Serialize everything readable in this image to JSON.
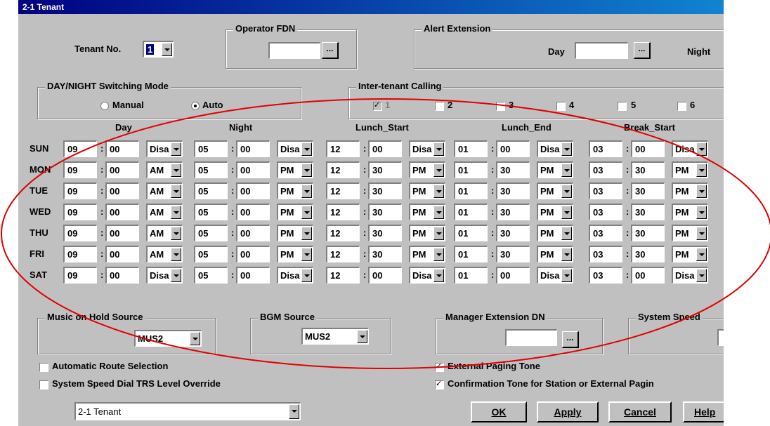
{
  "window": {
    "title": "2-1 Tenant"
  },
  "tenant": {
    "label": "Tenant No.",
    "value": "1"
  },
  "operator_fdn": {
    "label": "Operator FDN",
    "value": ""
  },
  "alert_extension": {
    "label": "Alert Extension",
    "day_label": "Day",
    "night_label": "Night",
    "day_value": ""
  },
  "switching_mode": {
    "label": "DAY/NIGHT Switching Mode",
    "manual_label": "Manual",
    "auto_label": "Auto",
    "selected": "Auto"
  },
  "inter_tenant": {
    "label": "Inter-tenant Calling",
    "options": [
      "1",
      "2",
      "3",
      "4",
      "5",
      "6"
    ]
  },
  "schedule": {
    "columns": [
      "Day",
      "Night",
      "Lunch_Start",
      "Lunch_End",
      "Break_Start"
    ],
    "rows": [
      {
        "day": "SUN",
        "cells": [
          [
            "09",
            "00",
            "Disa"
          ],
          [
            "05",
            "00",
            "Disa"
          ],
          [
            "12",
            "00",
            "Disa"
          ],
          [
            "01",
            "00",
            "Disa"
          ],
          [
            "03",
            "00",
            "Disa"
          ]
        ]
      },
      {
        "day": "MON",
        "cells": [
          [
            "09",
            "00",
            "AM"
          ],
          [
            "05",
            "00",
            "PM"
          ],
          [
            "12",
            "30",
            "PM"
          ],
          [
            "01",
            "30",
            "PM"
          ],
          [
            "03",
            "30",
            "PM"
          ]
        ]
      },
      {
        "day": "TUE",
        "cells": [
          [
            "09",
            "00",
            "AM"
          ],
          [
            "05",
            "00",
            "PM"
          ],
          [
            "12",
            "30",
            "PM"
          ],
          [
            "01",
            "30",
            "PM"
          ],
          [
            "03",
            "30",
            "PM"
          ]
        ]
      },
      {
        "day": "WED",
        "cells": [
          [
            "09",
            "00",
            "AM"
          ],
          [
            "05",
            "00",
            "PM"
          ],
          [
            "12",
            "30",
            "PM"
          ],
          [
            "01",
            "30",
            "PM"
          ],
          [
            "03",
            "30",
            "PM"
          ]
        ]
      },
      {
        "day": "THU",
        "cells": [
          [
            "09",
            "00",
            "AM"
          ],
          [
            "05",
            "00",
            "PM"
          ],
          [
            "12",
            "30",
            "PM"
          ],
          [
            "01",
            "30",
            "PM"
          ],
          [
            "03",
            "30",
            "PM"
          ]
        ]
      },
      {
        "day": "FRI",
        "cells": [
          [
            "09",
            "00",
            "AM"
          ],
          [
            "05",
            "00",
            "PM"
          ],
          [
            "12",
            "30",
            "PM"
          ],
          [
            "01",
            "30",
            "PM"
          ],
          [
            "03",
            "30",
            "PM"
          ]
        ]
      },
      {
        "day": "SAT",
        "cells": [
          [
            "09",
            "00",
            "Disa"
          ],
          [
            "05",
            "00",
            "Disa"
          ],
          [
            "12",
            "00",
            "Disa"
          ],
          [
            "01",
            "00",
            "Disa"
          ],
          [
            "03",
            "00",
            "Disa"
          ]
        ]
      }
    ]
  },
  "music_on_hold": {
    "label": "Music on Hold Source",
    "value": "MUS2"
  },
  "bgm_source": {
    "label": "BGM Source",
    "value": "MUS2"
  },
  "manager_extension": {
    "label": "Manager Extension DN",
    "value": ""
  },
  "system_speed": {
    "label": "System Speed"
  },
  "checkboxes": {
    "auto_route": "Automatic Route Selection",
    "speed_dial_override": "System Speed Dial TRS Level Override",
    "external_paging": "External Paging Tone",
    "confirmation_tone": "Confirmation Tone for Station or External Pagin"
  },
  "footer": {
    "selector": "2-1 Tenant",
    "ok_label": "OK",
    "apply_label": "Apply",
    "cancel_label": "Cancel",
    "help_label": "Help"
  },
  "annotation": {
    "color": "#e00000"
  }
}
